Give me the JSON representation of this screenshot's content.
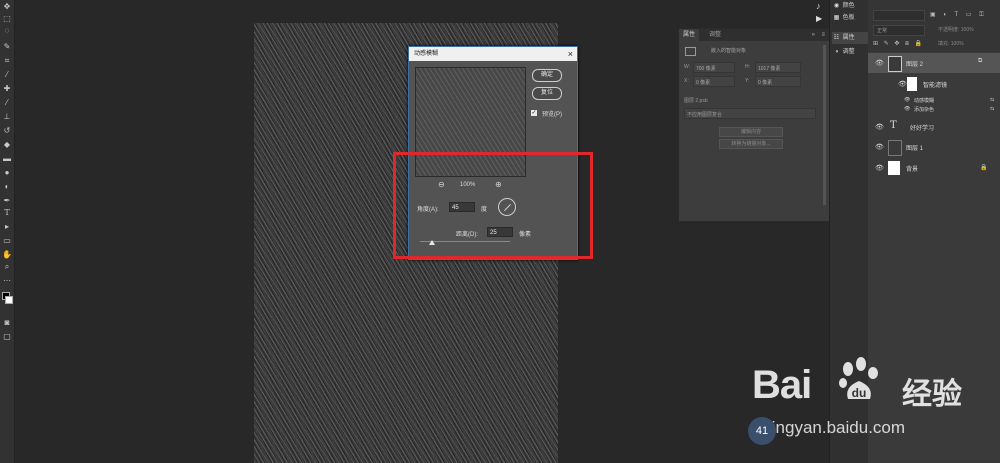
{
  "toolbar": {
    "icons": [
      "move-icon",
      "marquee-icon",
      "lasso-icon",
      "quick-select-icon",
      "crop-icon",
      "eyedropper-icon",
      "healing-icon",
      "brush-icon",
      "stamp-icon",
      "history-brush-icon",
      "eraser-icon",
      "gradient-icon",
      "blur-icon",
      "dodge-icon",
      "pen-icon",
      "type-icon",
      "path-select-icon",
      "shape-icon",
      "hand-icon",
      "zoom-icon",
      "more-icon",
      "color-swatches",
      "quickmask-icon",
      "screen-mode-icon"
    ]
  },
  "dialog": {
    "title": "动感模糊",
    "close": "×",
    "ok_label": "确定",
    "reset_label": "复位",
    "preview_label": "预览(P)",
    "preview_checked": true,
    "zoom_out": "⊖",
    "zoom_level": "100%",
    "zoom_in": "⊕",
    "angle_label": "角度(A):",
    "angle_value": "45",
    "angle_unit": "度",
    "distance_label": "距离(D):",
    "distance_value": "25",
    "distance_unit": "像素"
  },
  "properties_panel": {
    "tab_properties": "属性",
    "tab_adjust": "调整",
    "collapse": "»",
    "menu": "≡",
    "object_type": "嵌入的智能对象",
    "w_label": "W:",
    "w_value": "700 像素",
    "h_label": "H:",
    "h_value": "1017 像素",
    "x_label": "X:",
    "x_value": "0 像素",
    "y_label": "Y:",
    "y_value": "0 像素",
    "file_name": "图层 2.psb",
    "comps": "不应用图层复合",
    "edit_contents": "编辑内容",
    "convert_linked": "转换为链接对象..."
  },
  "icon_strip": {
    "color": "颜色",
    "swatches": "色板",
    "properties": "属性",
    "adjustments": "调整"
  },
  "layers_panel": {
    "blend_mode": "正常",
    "opacity_label": "不透明度: 100%",
    "fill_label": "填充: 100%",
    "layers": [
      {
        "name": "图层 2",
        "type": "smart-object"
      },
      {
        "name": "智能滤镜",
        "type": "filter-mask"
      },
      {
        "name": "动感模糊",
        "type": "filter"
      },
      {
        "name": "添加杂色",
        "type": "filter"
      },
      {
        "name": "好好学习",
        "type": "text"
      },
      {
        "name": "图层 1",
        "type": "normal"
      },
      {
        "name": "背景",
        "type": "background"
      }
    ]
  },
  "watermark": {
    "bai": "Bai",
    "jingyan": "经验",
    "url": "jingyan.baidu.com",
    "counter": "41"
  }
}
